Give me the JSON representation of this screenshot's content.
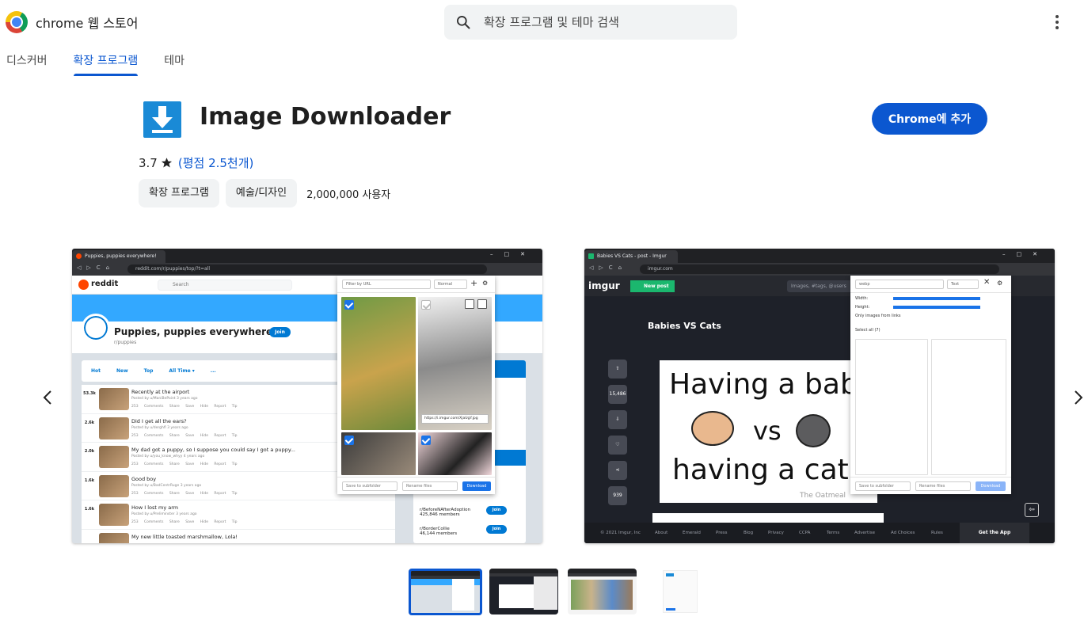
{
  "header": {
    "brand": "chrome 웹 스토어",
    "search_placeholder": "확장 프로그램 및 테마 검색"
  },
  "tabs": [
    {
      "label": "디스커버",
      "active": false
    },
    {
      "label": "확장 프로그램",
      "active": true
    },
    {
      "label": "테마",
      "active": false
    }
  ],
  "extension": {
    "title": "Image Downloader",
    "add_button": "Chrome에 추가",
    "rating_value": "3.7",
    "rating_link": "(평점 2.5천개)",
    "chips": [
      "확장 프로그램",
      "예술/디자인"
    ],
    "users": "2,000,000 사용자"
  },
  "colors": {
    "accent": "#0b57d0",
    "chip_bg": "#f1f3f4",
    "icon_blue": "#1a8ad6"
  },
  "screenshot1": {
    "tab_title": "Puppies, puppies everywhere!",
    "url": "reddit.com/r/puppies/top/?t=all",
    "logo": "reddit",
    "search": "Search",
    "subreddit_title": "Puppies, puppies everywhere!",
    "subreddit_name": "r/puppies",
    "join": "Join",
    "sort": [
      "Hot",
      "New",
      "Top",
      "All Time ▾",
      "..."
    ],
    "posts": [
      {
        "votes": "53.3k",
        "title": "Recently at the airport",
        "meta": "Posted by u/ManiBePoint 3 years ago"
      },
      {
        "votes": "2.6k",
        "title": "Did I get all the ears?",
        "meta": "Posted by u/derghfl 3 years ago"
      },
      {
        "votes": "2.0k",
        "title": "My dad got a puppy, so I suppose you could say I got a puppy...",
        "meta": "Posted by u/you_know_whyy 4 years ago"
      },
      {
        "votes": "1.6k",
        "title": "Good boy",
        "meta": "Posted by u/BadCentrRuge 3 years ago"
      },
      {
        "votes": "1.6k",
        "title": "How I lost my arm",
        "meta": "Posted by u/Preliminster 3 years ago"
      },
      {
        "votes": "",
        "title": "My new little toasted marshmallow, Lola!",
        "meta": ""
      }
    ],
    "post_actions": "253 Comments  Share  Save  Hide  Report  Tip",
    "sidebar": [
      {
        "name": "r/BeforeNAfterAdoption",
        "members": "425,846 members"
      },
      {
        "name": "r/BorderCollie",
        "members": "46,144 members"
      }
    ],
    "popup": {
      "filter_placeholder": "Filter by URL",
      "mode": "Normal",
      "url_chip": "https://i.imgur.com/XjaUgY.jpg",
      "subfolder": "Save to subfolder",
      "rename": "Rename files",
      "download": "Download"
    }
  },
  "screenshot2": {
    "tab_title": "Babies VS Cats - post - Imgur",
    "url": "imgur.com",
    "logo": "imgur",
    "new_post": "New post",
    "search": "Images, #tags, @users",
    "post_title": "Babies VS Cats",
    "art": [
      "Having a baby",
      "vs",
      "having a cat",
      "The Oatmeal"
    ],
    "side_counts": [
      "15,486",
      "939"
    ],
    "popup": {
      "filter": "webp",
      "mode": "Text",
      "width_label": "Width:",
      "height_label": "Height:",
      "only_links": "Only images from links",
      "select_all": "Select all (7)",
      "subfolder": "Save to subfolder",
      "rename": "Rename files",
      "download": "Download"
    },
    "footer": [
      "© 2021 Imgur, Inc",
      "About",
      "Emerald",
      "Press",
      "Blog",
      "Privacy",
      "CCPA",
      "Terms",
      "Advertise",
      "Ad Choices",
      "Rules",
      "•••"
    ],
    "get_app": "Get the App"
  }
}
